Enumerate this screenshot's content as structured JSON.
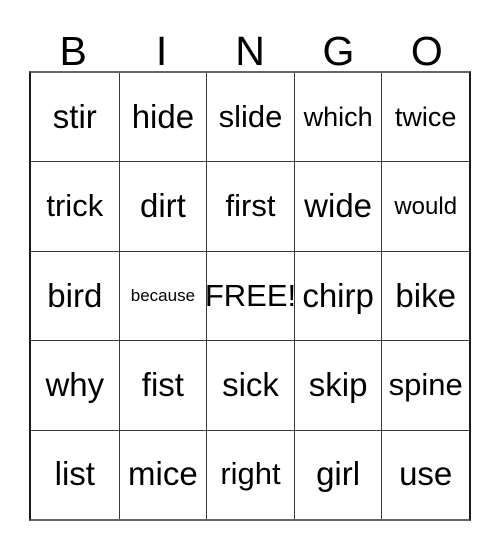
{
  "card": {
    "headers": [
      "B",
      "I",
      "N",
      "G",
      "O"
    ],
    "rows": [
      [
        {
          "text": "stir",
          "size": "xl"
        },
        {
          "text": "hide",
          "size": "xl"
        },
        {
          "text": "slide",
          "size": "lg"
        },
        {
          "text": "which",
          "size": "md"
        },
        {
          "text": "twice",
          "size": "md"
        }
      ],
      [
        {
          "text": "trick",
          "size": "lg"
        },
        {
          "text": "dirt",
          "size": "xl"
        },
        {
          "text": "first",
          "size": "lg"
        },
        {
          "text": "wide",
          "size": "xl"
        },
        {
          "text": "would",
          "size": "sm"
        }
      ],
      [
        {
          "text": "bird",
          "size": "xl"
        },
        {
          "text": "because",
          "size": "xs"
        },
        {
          "text": "FREE!",
          "size": "lg"
        },
        {
          "text": "chirp",
          "size": "xl"
        },
        {
          "text": "bike",
          "size": "xl"
        }
      ],
      [
        {
          "text": "why",
          "size": "xl"
        },
        {
          "text": "fist",
          "size": "xl"
        },
        {
          "text": "sick",
          "size": "xl"
        },
        {
          "text": "skip",
          "size": "xl"
        },
        {
          "text": "spine",
          "size": "lg"
        }
      ],
      [
        {
          "text": "list",
          "size": "xl"
        },
        {
          "text": "mice",
          "size": "xl"
        },
        {
          "text": "right",
          "size": "lg"
        },
        {
          "text": "girl",
          "size": "xl"
        },
        {
          "text": "use",
          "size": "xl"
        }
      ]
    ],
    "free_space": "FREE!",
    "colors": {
      "text": "#000000",
      "background": "#ffffff",
      "grid_line": "#3a3a3a",
      "outer_border": "#666666"
    }
  }
}
